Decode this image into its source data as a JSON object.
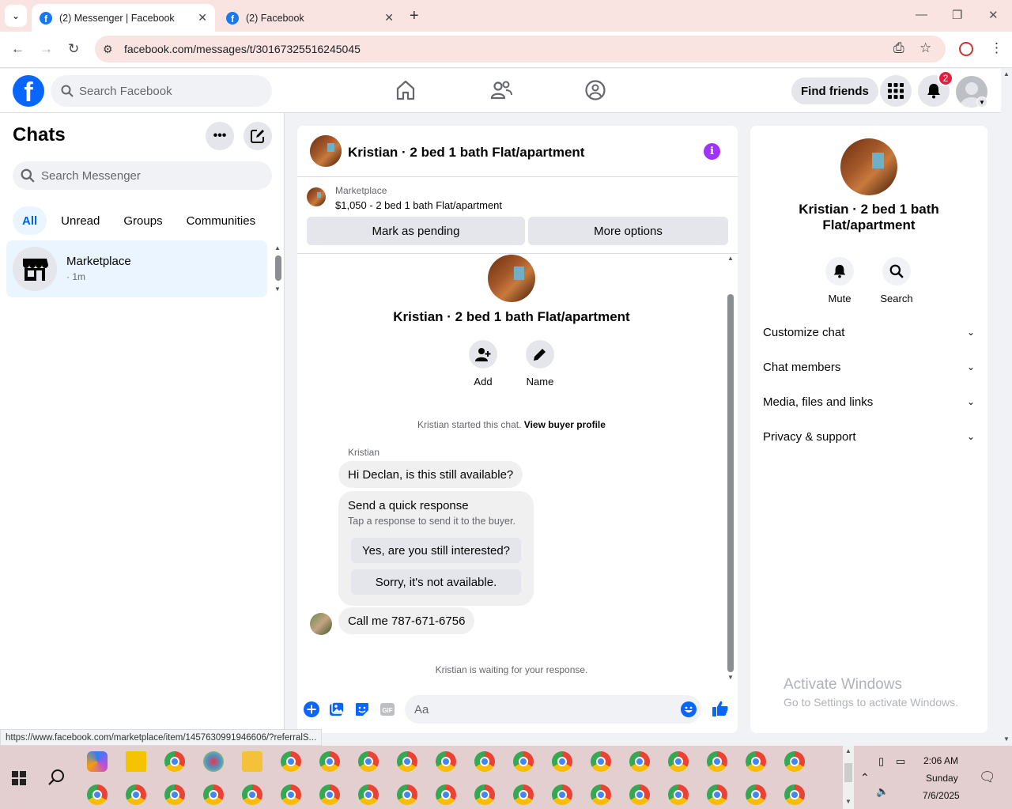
{
  "browser": {
    "tabs": [
      {
        "title": "(2) Messenger | Facebook",
        "active": true
      },
      {
        "title": "(2) Facebook",
        "active": false
      }
    ],
    "url": "facebook.com/messages/t/30167325516245045",
    "status_url": "https://www.facebook.com/marketplace/item/1457630991946606/?referralS..."
  },
  "fb_header": {
    "logo": "f",
    "search_placeholder": "Search Facebook",
    "find_friends": "Find friends",
    "notification_count": "2"
  },
  "left": {
    "title": "Chats",
    "search_placeholder": "Search Messenger",
    "filters": [
      "All",
      "Unread",
      "Groups",
      "Communities"
    ],
    "chat": {
      "name": "Marketplace",
      "time": "· 1m"
    }
  },
  "conversation": {
    "title": "Kristian · 2 bed 1 bath Flat/apartment",
    "marketplace_label": "Marketplace",
    "listing": "$1,050 - 2 bed 1 bath Flat/apartment",
    "mark_pending": "Mark as pending",
    "more_options": "More options",
    "profile_name": "Kristian · 2 bed 1 bath Flat/apartment",
    "add_label": "Add",
    "name_label": "Name",
    "started_text": "Kristian started this chat.",
    "view_profile": "View buyer profile",
    "sender": "Kristian",
    "msg1": "Hi Declan, is this still available?",
    "quick_title": "Send a quick response",
    "quick_sub": "Tap a response to send it to the buyer.",
    "quick1": "Yes, are you still interested?",
    "quick2": "Sorry, it's not available.",
    "msg2": "Call me 787-671-6756",
    "waiting": "Kristian is waiting for your response.",
    "composer_placeholder": "Aa"
  },
  "right": {
    "name": "Kristian · 2 bed 1 bath Flat/apartment",
    "mute": "Mute",
    "search": "Search",
    "sections": [
      "Customize chat",
      "Chat members",
      "Media, files and links",
      "Privacy & support"
    ],
    "watermark_title": "Activate Windows",
    "watermark_sub": "Go to Settings to activate Windows."
  },
  "taskbar": {
    "time": "2:06 AM",
    "day": "Sunday",
    "date": "7/6/2025"
  },
  "colors": {
    "fb_blue": "#0866ff",
    "accent_purple": "#a033ff",
    "badge_red": "#e41e3f",
    "tab_bg": "#f9e4e1"
  }
}
